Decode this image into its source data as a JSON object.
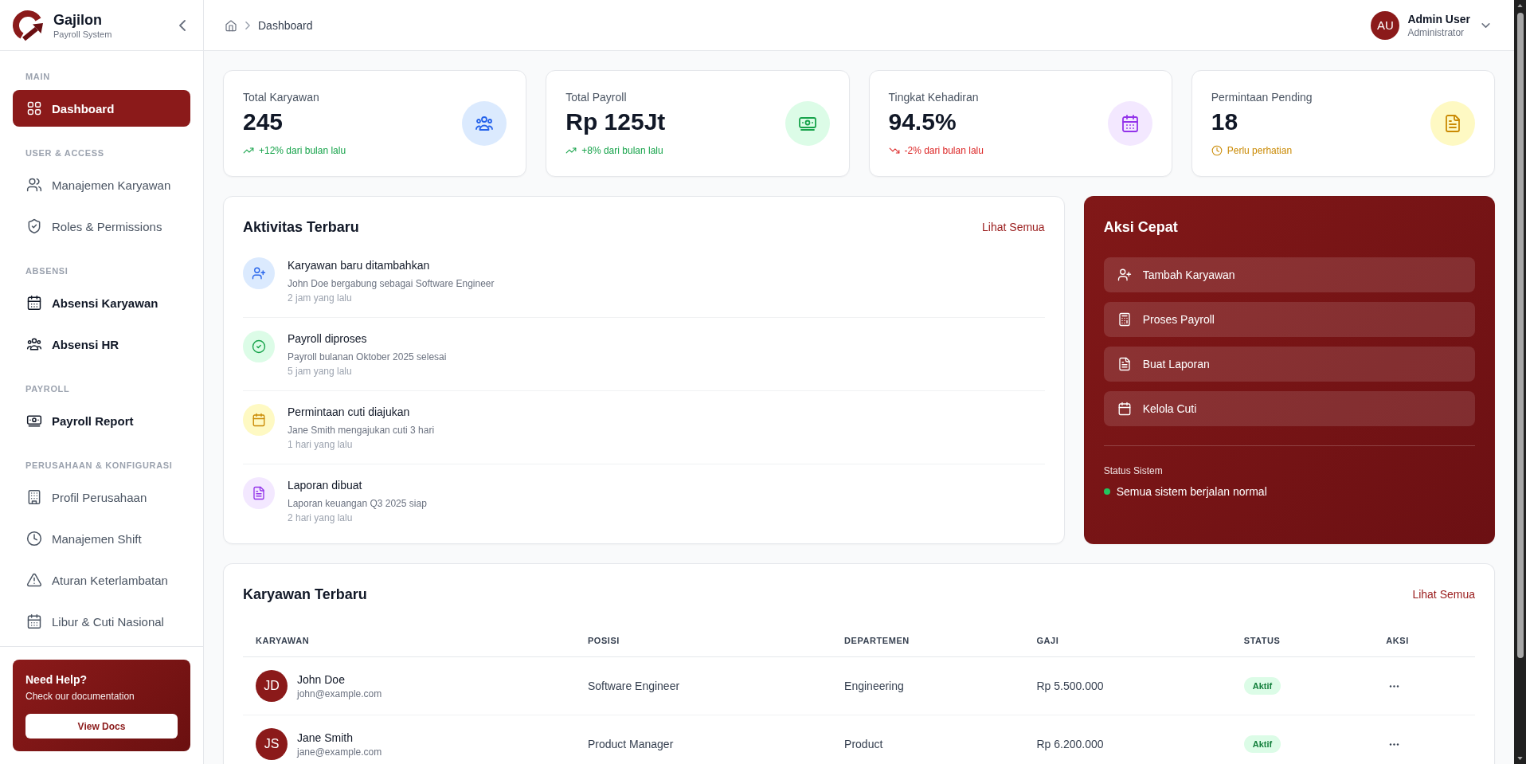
{
  "sidebar": {
    "brand": {
      "name": "Gajilon",
      "subtitle": "Payroll System"
    },
    "sections": [
      {
        "title": "MAIN",
        "items": [
          {
            "label": "Dashboard",
            "selected": true,
            "emphasized": true
          }
        ]
      },
      {
        "title": "USER & ACCESS",
        "items": [
          {
            "label": "Manajemen Karyawan",
            "selected": false,
            "emphasized": false
          },
          {
            "label": "Roles & Permissions",
            "selected": false,
            "emphasized": false
          }
        ]
      },
      {
        "title": "ABSENSI",
        "items": [
          {
            "label": "Absensi Karyawan",
            "selected": false,
            "emphasized": true
          },
          {
            "label": "Absensi HR",
            "selected": false,
            "emphasized": true
          }
        ]
      },
      {
        "title": "PAYROLL",
        "items": [
          {
            "label": "Payroll Report",
            "selected": false,
            "emphasized": true
          }
        ]
      },
      {
        "title": "PERUSAHAAN & KONFIGURASI",
        "items": [
          {
            "label": "Profil Perusahaan",
            "selected": false,
            "emphasized": false
          },
          {
            "label": "Manajemen Shift",
            "selected": false,
            "emphasized": false
          },
          {
            "label": "Aturan Keterlambatan",
            "selected": false,
            "emphasized": false
          },
          {
            "label": "Libur & Cuti Nasional",
            "selected": false,
            "emphasized": false
          }
        ]
      }
    ],
    "help": {
      "title": "Need Help?",
      "text": "Check our documentation",
      "button": "View Docs"
    }
  },
  "header": {
    "breadcrumb": [
      "Dashboard"
    ],
    "user": {
      "initials": "AU",
      "name": "Admin User",
      "role": "Administrator"
    }
  },
  "stats": [
    {
      "label": "Total Karyawan",
      "value": "245",
      "note": "+12% dari bulan lalu",
      "kind": "up"
    },
    {
      "label": "Total Payroll",
      "value": "Rp 125Jt",
      "note": "+8% dari bulan lalu",
      "kind": "up"
    },
    {
      "label": "Tingkat Kehadiran",
      "value": "94.5%",
      "note": "-2% dari bulan lalu",
      "kind": "down"
    },
    {
      "label": "Permintaan Pending",
      "value": "18",
      "note": "Perlu perhatian",
      "kind": "pending"
    }
  ],
  "activity": {
    "title": "Aktivitas Terbaru",
    "link": "Lihat Semua",
    "items": [
      {
        "title": "Karyawan baru ditambahkan",
        "description": "John Doe bergabung sebagai Software Engineer",
        "time": "2 jam yang lalu"
      },
      {
        "title": "Payroll diproses",
        "description": "Payroll bulanan Oktober 2025 selesai",
        "time": "5 jam yang lalu"
      },
      {
        "title": "Permintaan cuti diajukan",
        "description": "Jane Smith mengajukan cuti 3 hari",
        "time": "1 hari yang lalu"
      },
      {
        "title": "Laporan dibuat",
        "description": "Laporan keuangan Q3 2025 siap",
        "time": "2 hari yang lalu"
      }
    ]
  },
  "quick_actions": {
    "title": "Aksi Cepat",
    "actions": [
      "Tambah Karyawan",
      "Proses Payroll",
      "Buat Laporan",
      "Kelola Cuti"
    ],
    "status": {
      "label": "Status Sistem",
      "text": "Semua sistem berjalan normal",
      "healthy": true
    }
  },
  "employees": {
    "title": "Karyawan Terbaru",
    "link": "Lihat Semua",
    "columns": [
      "KARYAWAN",
      "POSISI",
      "DEPARTEMEN",
      "GAJI",
      "STATUS",
      "AKSI"
    ],
    "rows": [
      {
        "initials": "JD",
        "name": "John Doe",
        "email": "john@example.com",
        "position": "Software Engineer",
        "department": "Engineering",
        "salary": "Rp 5.500.000",
        "status": "Aktif"
      },
      {
        "initials": "JS",
        "name": "Jane Smith",
        "email": "jane@example.com",
        "position": "Product Manager",
        "department": "Product",
        "salary": "Rp 6.200.000",
        "status": "Aktif"
      }
    ]
  }
}
